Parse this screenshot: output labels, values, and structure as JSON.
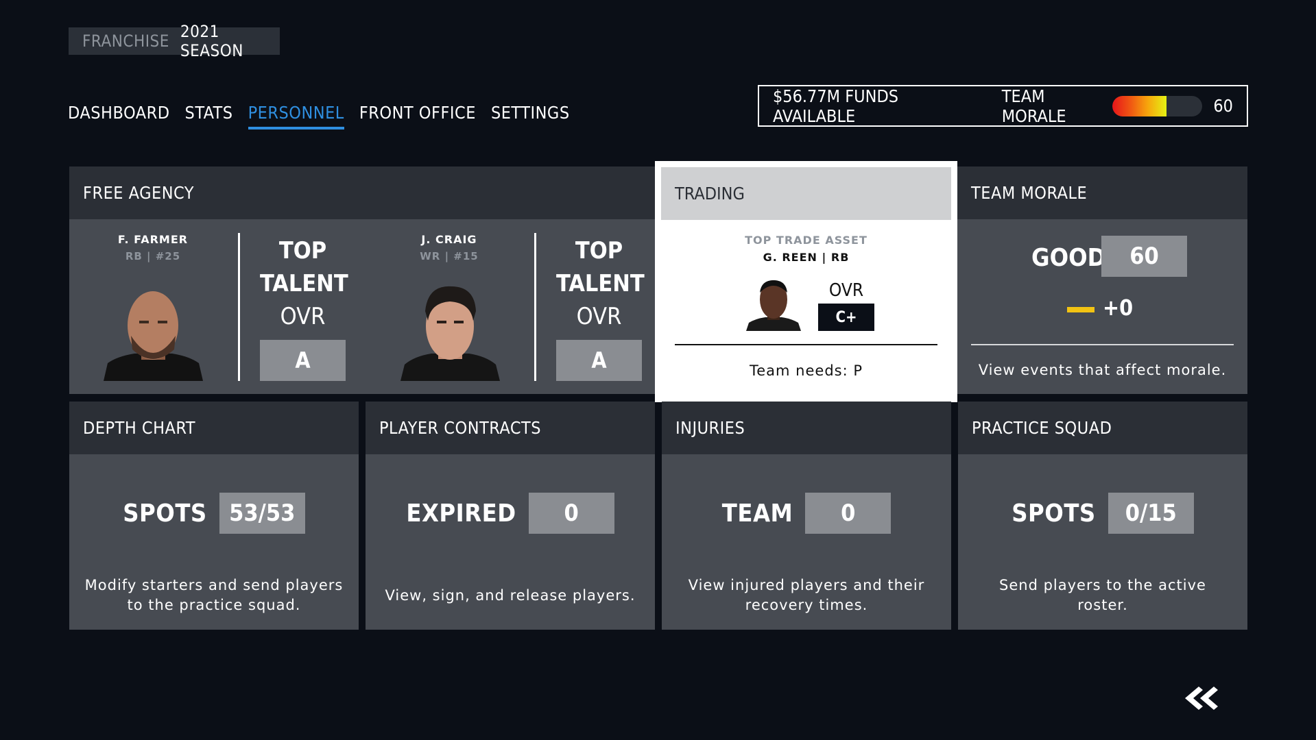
{
  "header": {
    "franchise_label": "FRANCHISE",
    "season_label": "2021 SEASON"
  },
  "nav": {
    "items": [
      "DASHBOARD",
      "STATS",
      "PERSONNEL",
      "FRONT OFFICE",
      "SETTINGS"
    ],
    "active": "PERSONNEL"
  },
  "status": {
    "funds": "$56.77M FUNDS AVAILABLE",
    "morale_label": "TEAM MORALE",
    "morale_value": "60",
    "morale_fraction": 0.6,
    "morale_colors": [
      "#e8151a",
      "#f7a40c",
      "#e5f214"
    ]
  },
  "free_agency": {
    "title": "FREE AGENCY",
    "players": [
      {
        "name": "F. FARMER",
        "pos": "RB  |  #25",
        "talent_line1": "TOP",
        "talent_line2": "TALENT",
        "ovr_label": "OVR",
        "grade": "A"
      },
      {
        "name": "J. CRAIG",
        "pos": "WR  |  #15",
        "talent_line1": "TOP",
        "talent_line2": "TALENT",
        "ovr_label": "OVR",
        "grade": "A"
      }
    ]
  },
  "trading": {
    "title": "TRADING",
    "asset_label": "TOP TRADE ASSET",
    "asset_name": "G. REEN | RB",
    "ovr_label": "OVR",
    "grade": "C+",
    "needs": "Team needs: P"
  },
  "team_morale": {
    "title": "TEAM MORALE",
    "status": "GOOD",
    "value": "60",
    "delta": "+0",
    "delta_color": "#f2c313",
    "description": "View events that affect morale."
  },
  "cards": [
    {
      "title": "DEPTH CHART",
      "label": "SPOTS",
      "value": "53/53",
      "description": "Modify starters and send players to the practice squad."
    },
    {
      "title": "PLAYER CONTRACTS",
      "label": "EXPIRED",
      "value": "0",
      "description": "View, sign, and release players."
    },
    {
      "title": "INJURIES",
      "label": "TEAM",
      "value": "0",
      "description": "View injured players and their recovery times."
    },
    {
      "title": "PRACTICE SQUAD",
      "label": "SPOTS",
      "value": "0/15",
      "description": "Send players to the active roster."
    }
  ],
  "colors": {
    "accent": "#2f8fe0",
    "background": "#0b0f17",
    "panel": "#474b52",
    "panel_header": "#2b2f36",
    "grade_box": "#8a8d92"
  },
  "icons": {
    "back": "double-chevron-left-icon"
  }
}
